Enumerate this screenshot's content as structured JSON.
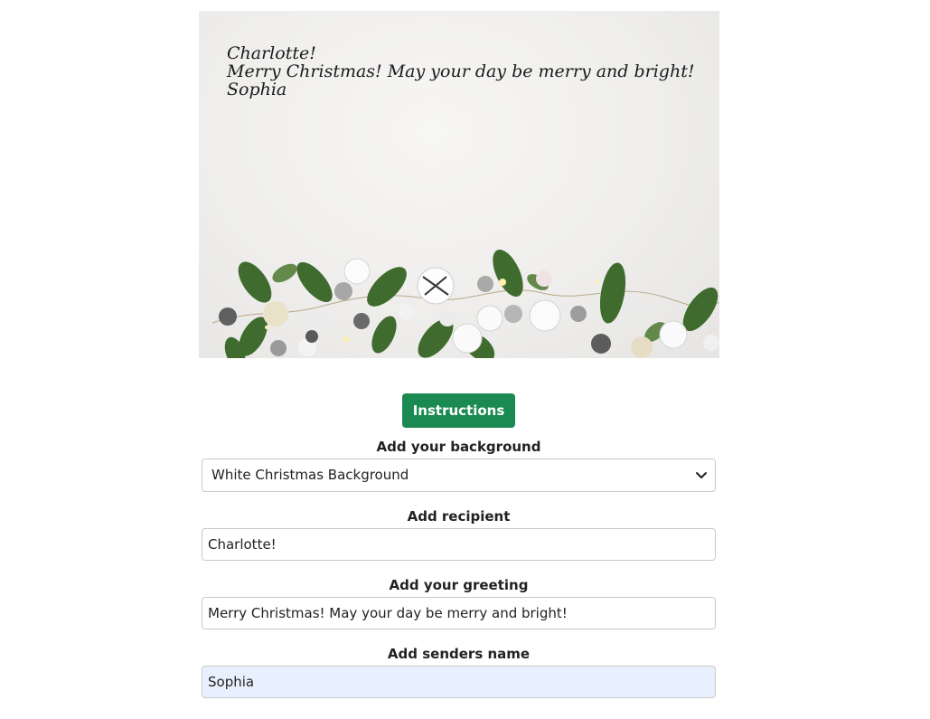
{
  "card": {
    "recipient": "Charlotte!",
    "greeting": "Merry Christmas! May your day be merry and bright!",
    "sender": "Sophia"
  },
  "instructions_button": "Instructions",
  "background": {
    "label": "Add your background",
    "selected": "White Christmas Background"
  },
  "recipient": {
    "label": "Add recipient",
    "value": "Charlotte!"
  },
  "greeting": {
    "label": "Add your greeting",
    "value": "Merry Christmas! May your day be merry and bright!"
  },
  "sender": {
    "label": "Add senders name",
    "value": "Sophia"
  },
  "colors": {
    "button": "#1b8a52",
    "autofill": "#e8f0fe"
  }
}
